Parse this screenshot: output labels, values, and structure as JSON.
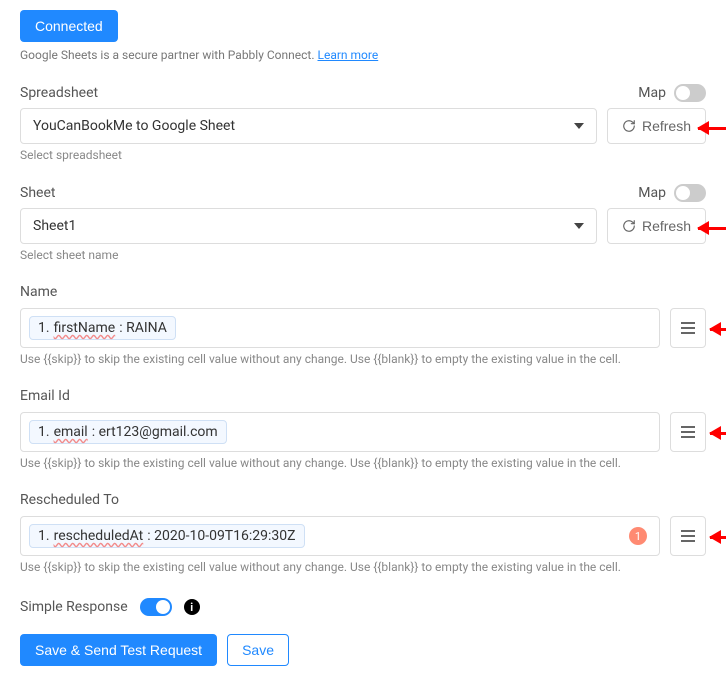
{
  "header": {
    "connected_label": "Connected",
    "notice": "Google Sheets is a secure partner with Pabbly Connect.",
    "learn_more": "Learn more"
  },
  "spreadsheet": {
    "label": "Spreadsheet",
    "map_label": "Map",
    "value": "YouCanBookMe to Google Sheet",
    "refresh": "Refresh",
    "helper": "Select spreadsheet"
  },
  "sheet": {
    "label": "Sheet",
    "map_label": "Map",
    "value": "Sheet1",
    "refresh": "Refresh",
    "helper": "Select sheet name"
  },
  "fields_helper": "Use {{skip}} to skip the existing cell value without any change. Use {{blank}} to empty the existing value in the cell.",
  "name": {
    "label": "Name",
    "chip_num": "1",
    "chip_key": "firstName",
    "chip_val": "RAINA"
  },
  "email": {
    "label": "Email Id",
    "chip_num": "1",
    "chip_key": "email",
    "chip_val": "ert123@gmail.com"
  },
  "rescheduled": {
    "label": "Rescheduled To",
    "chip_num": "1",
    "chip_key": "rescheduledAt",
    "chip_val": "2020-10-09T16:29:30Z",
    "badge": "1"
  },
  "simple_response": {
    "label": "Simple Response"
  },
  "footer": {
    "save_test": "Save & Send Test Request",
    "save": "Save"
  }
}
